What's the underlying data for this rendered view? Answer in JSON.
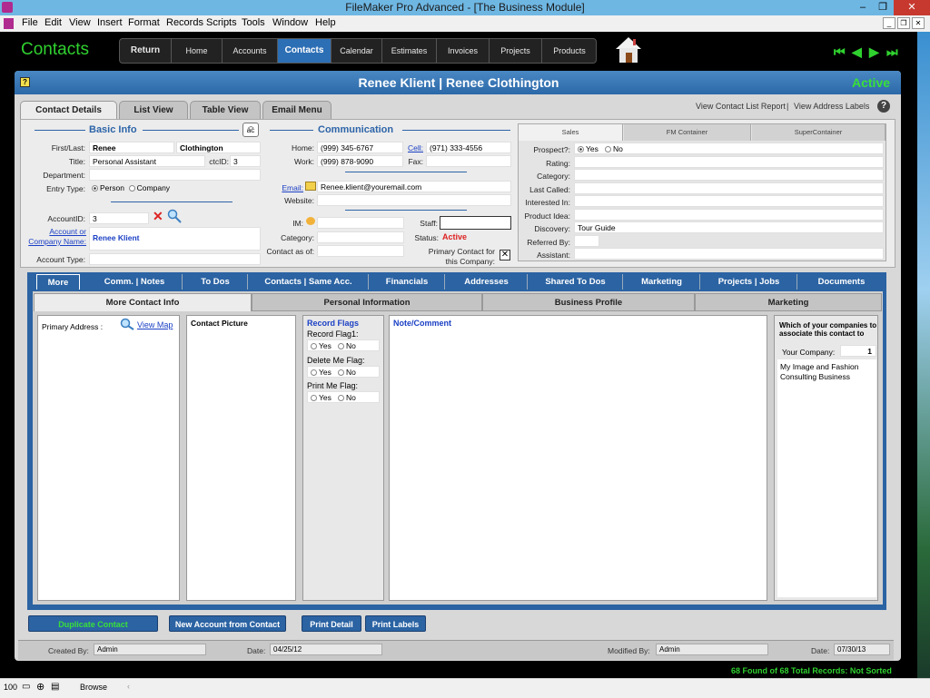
{
  "window": {
    "title": "FileMaker Pro Advanced - [The Business Module]"
  },
  "menu": [
    "File",
    "Edit",
    "View",
    "Insert",
    "Format",
    "Records",
    "Scripts",
    "Tools",
    "Window",
    "Help"
  ],
  "header": {
    "title": "Contacts",
    "nav": [
      "Return",
      "Home",
      "Accounts",
      "Contacts",
      "Calendar",
      "Estimates",
      "Invoices",
      "Projects",
      "Products"
    ],
    "active_nav": "Contacts"
  },
  "record": {
    "title": "Renee Klient | Renee Clothington",
    "status": "Active"
  },
  "tabs": {
    "items": [
      "Contact Details",
      "List View",
      "Table View",
      "Email Menu"
    ],
    "selected": "Contact Details"
  },
  "links": {
    "report": "View Contact List Report",
    "sep": "|",
    "labels": "View Address Labels"
  },
  "basic": {
    "section": "Basic Info",
    "first_last_label": "First/Last:",
    "first": "Renee",
    "last": "Clothington",
    "title_label": "Title:",
    "title": "Personal Assistant",
    "ctcid_label": "ctcID:",
    "ctcid": "3",
    "department_label": "Department:",
    "department": "",
    "entry_type_label": "Entry Type:",
    "entry_person": "Person",
    "entry_company": "Company",
    "accountid_label": "AccountID:",
    "accountid": "3",
    "account_label_1": "Account or",
    "account_label_2": "Company Name:",
    "account_name": "Renee Klient",
    "account_type_label": "Account Type:",
    "account_type": ""
  },
  "comm": {
    "section": "Communication",
    "home_label": "Home:",
    "home": "(999) 345-6767",
    "cell_label": "Cell:",
    "cell": "(971) 333-4556",
    "work_label": "Work:",
    "work": "(999) 878-9090",
    "fax_label": "Fax:",
    "fax": "",
    "email_label": "Email:",
    "email": "Renee.klient@youremail.com",
    "website_label": "Website:",
    "website": "",
    "im_label": "IM:",
    "im": "",
    "staff_label": "Staff:",
    "staff": "",
    "category_label": "Category:",
    "category": "",
    "status_label": "Status:",
    "status": "Active",
    "contact_as_of_label": "Contact as of:",
    "contact_as_of": "",
    "primary_label_1": "Primary Contact for",
    "primary_label_2": "this Company:"
  },
  "right_panel": {
    "tabs": [
      "Sales",
      "FM Container",
      "SuperContainer"
    ],
    "prospect_label": "Prospect?:",
    "yes": "Yes",
    "no": "No",
    "rating_label": "Rating:",
    "category_label": "Category:",
    "last_called_label": "Last Called:",
    "interested_label": "Interested In:",
    "product_idea_label": "Product Idea:",
    "discovery_label": "Discovery:",
    "discovery": "Tour Guide",
    "referred_label": "Referred By:",
    "assistant_label": "Assistant:"
  },
  "blue_tabs": [
    "More",
    "Comm. | Notes",
    "To Dos",
    "Contacts | Same Acc.",
    "Financials",
    "Addresses",
    "Shared To Dos",
    "Marketing",
    "Projects | Jobs",
    "Documents"
  ],
  "inner_tabs": [
    "More Contact Info",
    "Personal Information",
    "Business Profile",
    "Marketing"
  ],
  "more": {
    "primary_address_label": "Primary Address :",
    "view_map": "View Map",
    "contact_picture": "Contact Picture",
    "record_flags": "Record Flags",
    "flag1": "Record Flag1:",
    "delete_flag": "Delete Me Flag:",
    "print_flag": "Print Me Flag:",
    "yes": "Yes",
    "no": "No",
    "note": "Note/Comment",
    "company_q": "Which of your companies to associate this contact to",
    "your_company_label": "Your Company:",
    "your_company": "1",
    "company_name": "My Image and Fashion Consulting Business"
  },
  "buttons": [
    "Duplicate Contact",
    "New Account from Contact",
    "Print Detail",
    "Print Labels"
  ],
  "footer": {
    "created_by_label": "Created By:",
    "created_by": "Admin",
    "date_label": "Date:",
    "created_date": "04/25/12",
    "modified_by_label": "Modified By:",
    "modified_by": "Admin",
    "modified_date": "07/30/13"
  },
  "found": "68 Found of 68 Total Records: Not Sorted",
  "statusbar": {
    "zoom": "100",
    "mode": "Browse"
  }
}
